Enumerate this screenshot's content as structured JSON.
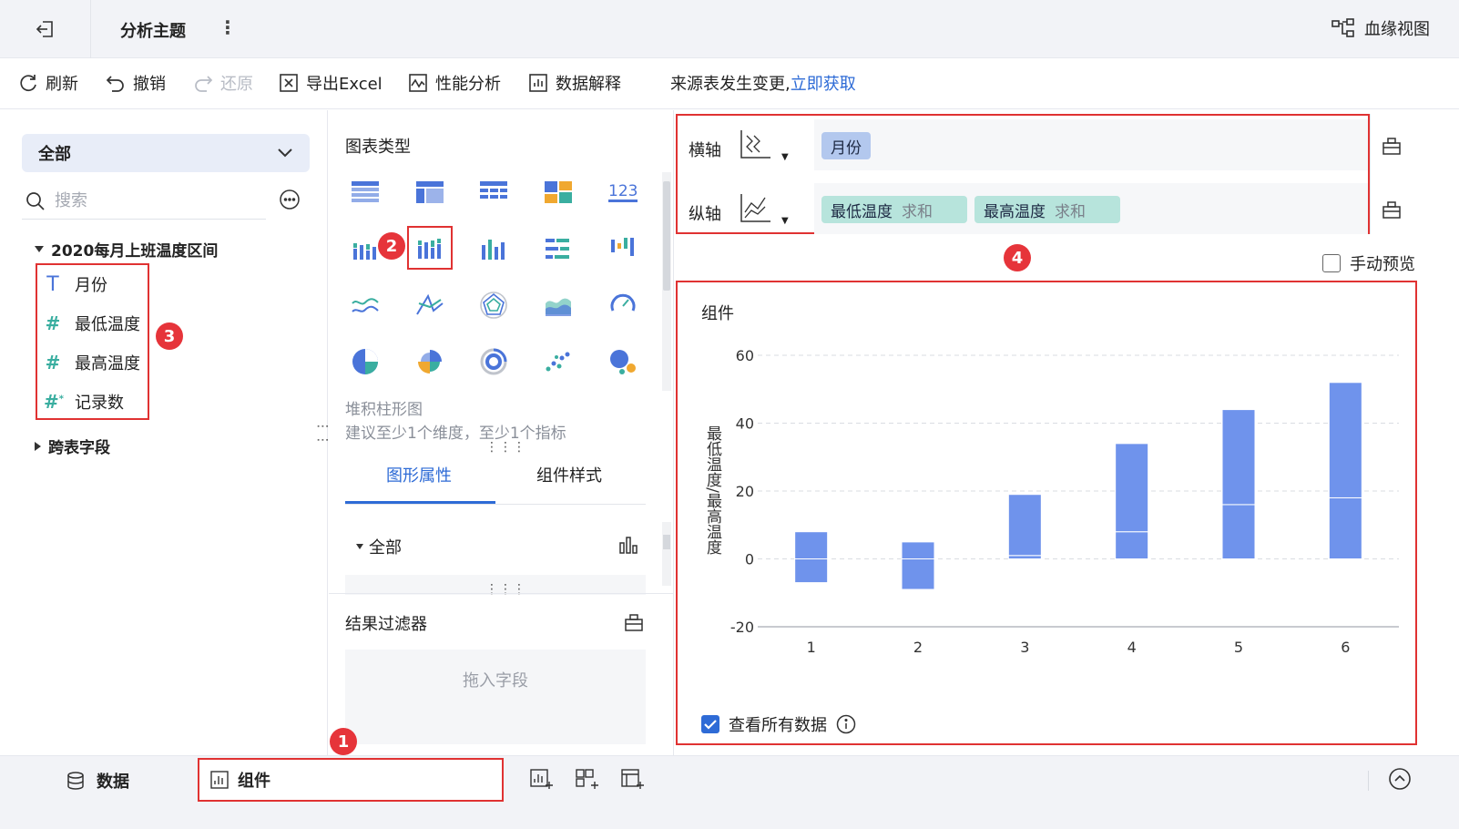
{
  "header": {
    "title": "分析主题",
    "lineage_label": "血缘视图"
  },
  "toolbar": {
    "refresh": "刷新",
    "undo": "撤销",
    "redo": "还原",
    "export_excel": "导出Excel",
    "perf_analysis": "性能分析",
    "data_explain": "数据解释",
    "source_changed": "来源表发生变更,",
    "fetch_now": "立即获取"
  },
  "left_panel": {
    "scope": "全部",
    "search_placeholder": "搜索",
    "table_name": "2020每月上班温度区间",
    "fields": [
      {
        "name": "月份",
        "type": "text"
      },
      {
        "name": "最低温度",
        "type": "number"
      },
      {
        "name": "最高温度",
        "type": "number"
      },
      {
        "name": "记录数",
        "type": "count"
      }
    ],
    "cross_fields": "跨表字段"
  },
  "middle_panel": {
    "chart_type_title": "图表类型",
    "selected_chart_name": "堆积柱形图",
    "selected_chart_hint": "建议至少1个维度，至少1个指标",
    "tabs": [
      "图形属性",
      "组件样式"
    ],
    "props_all": "全部",
    "filter_title": "结果过滤器",
    "filter_drop_hint": "拖入字段"
  },
  "axes": {
    "x_label": "横轴",
    "y_label": "纵轴",
    "x_fields": [
      "月份"
    ],
    "y_fields": [
      {
        "name": "最低温度",
        "agg": "求和"
      },
      {
        "name": "最高温度",
        "agg": "求和"
      }
    ]
  },
  "manual_preview": "手动预览",
  "component_title": "组件",
  "view_all_data": "查看所有数据",
  "chart_data": {
    "type": "bar",
    "stacked": true,
    "categories": [
      "1",
      "2",
      "3",
      "4",
      "5",
      "6"
    ],
    "series": [
      {
        "values": [
          -7,
          -9,
          1,
          8,
          16,
          18
        ]
      },
      {
        "values": [
          8,
          5,
          18,
          26,
          28,
          34
        ]
      }
    ],
    "ylabel": "最低温度/最高温度",
    "ylim": [
      -20,
      60
    ],
    "yticks": [
      -20,
      0,
      20,
      40,
      60
    ],
    "grid": true,
    "color": "#6f93ec"
  },
  "badges": [
    "1",
    "2",
    "3",
    "4"
  ],
  "bottom_bar": {
    "data_tab": "数据",
    "component_tab": "组件"
  },
  "colors": {
    "accent": "#2e6bd6",
    "highlight": "#e03232",
    "bar": "#6f93ec"
  }
}
